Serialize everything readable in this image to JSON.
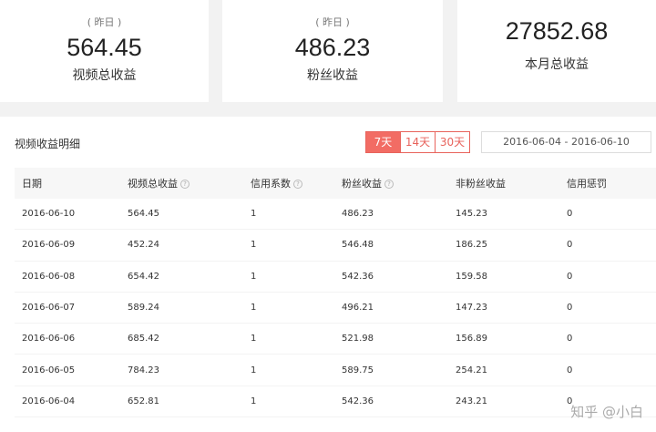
{
  "cards": [
    {
      "sub": "( 昨日 )",
      "value": "564.45",
      "label": "视频总收益"
    },
    {
      "sub": "( 昨日 )",
      "value": "486.23",
      "label": "粉丝收益"
    },
    {
      "sub": "",
      "value": "27852.68",
      "label": "本月总收益"
    }
  ],
  "panel": {
    "title": "视频收益明细",
    "ranges": [
      {
        "label": "7天",
        "active": true
      },
      {
        "label": "14天",
        "active": false
      },
      {
        "label": "30天",
        "active": false
      }
    ],
    "date_range": "2016-06-04 - 2016-06-10"
  },
  "table": {
    "headers": [
      "日期",
      "视频总收益",
      "信用系数",
      "粉丝收益",
      "非粉丝收益",
      "信用惩罚"
    ],
    "help_icon": "?",
    "rows": [
      [
        "2016-06-10",
        "564.45",
        "1",
        "486.23",
        "145.23",
        "0"
      ],
      [
        "2016-06-09",
        "452.24",
        "1",
        "546.48",
        "186.25",
        "0"
      ],
      [
        "2016-06-08",
        "654.42",
        "1",
        "542.36",
        "159.58",
        "0"
      ],
      [
        "2016-06-07",
        "589.24",
        "1",
        "496.21",
        "147.23",
        "0"
      ],
      [
        "2016-06-06",
        "685.42",
        "1",
        "521.98",
        "156.89",
        "0"
      ],
      [
        "2016-06-05",
        "784.23",
        "1",
        "589.75",
        "254.21",
        "0"
      ],
      [
        "2016-06-04",
        "652.81",
        "1",
        "542.36",
        "243.21",
        "0"
      ]
    ]
  },
  "watermark": "知乎 @小白"
}
